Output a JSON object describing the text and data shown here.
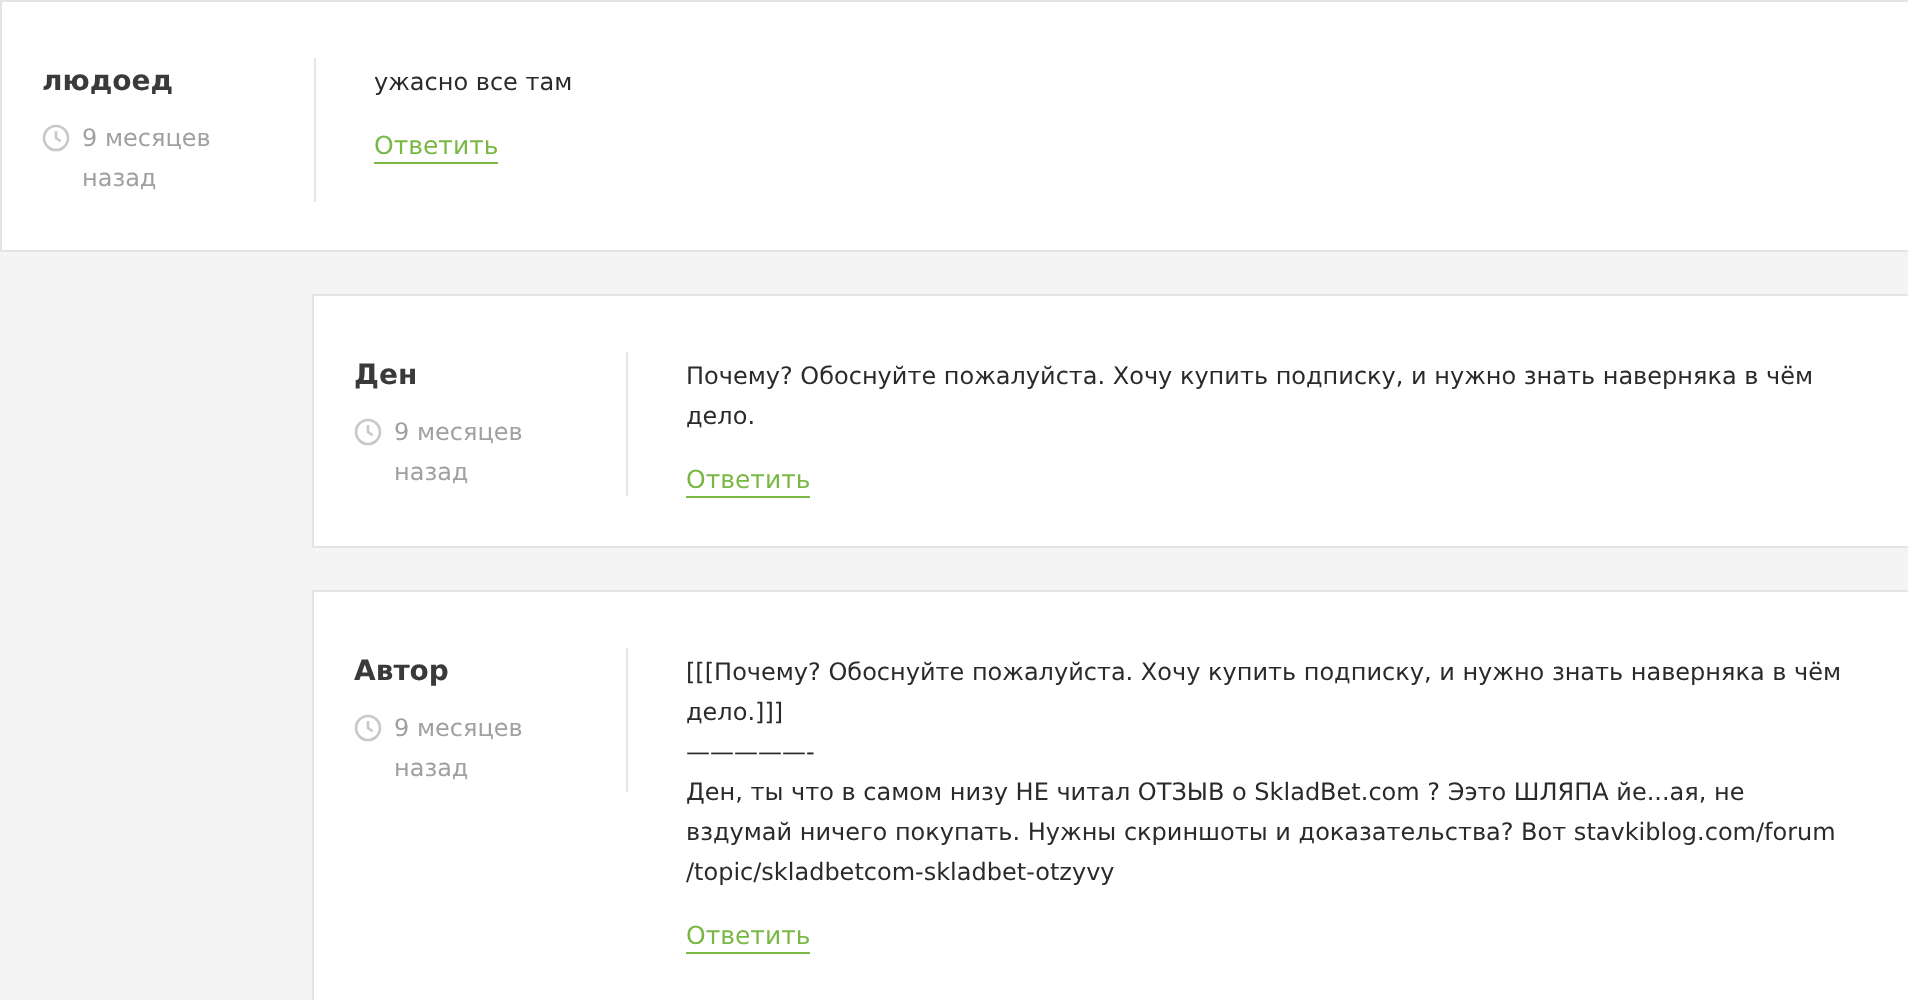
{
  "comments": [
    {
      "author": "людоед",
      "time": "9 месяцев назад",
      "lines": [
        "ужасно все там"
      ],
      "reply": "Ответить",
      "nested": false
    },
    {
      "author": "Ден",
      "time": "9 месяцев назад",
      "lines": [
        "Почему? Обоснуйте пожалуйста. Хочу купить подписку, и нужно знать наверняка в чём",
        "дело."
      ],
      "reply": "Ответить",
      "nested": true
    },
    {
      "author": "Автор",
      "time": "9 месяцев назад",
      "lines": [
        "[[[Почему? Обоснуйте пожалуйста. Хочу купить подписку, и нужно знать наверняка в чём",
        "дело.]]]",
        "—————-",
        "Ден, ты что в самом низу НЕ читал ОТЗЫВ о SkladBet.com ? Ээто ШЛЯПА йе...ая, не",
        "вздумай ничего покупать. Нужны скриншоты и доказательства? Вот stavkiblog.com/forum",
        "/topic/skladbetcom-skladbet-otzyvy"
      ],
      "reply": "Ответить",
      "nested": true
    }
  ]
}
